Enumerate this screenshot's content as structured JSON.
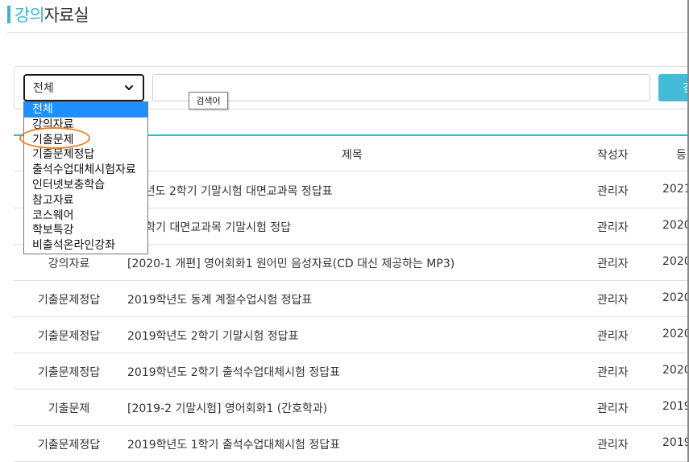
{
  "page": {
    "title_accent": "강의",
    "title_rest": "자료실"
  },
  "search": {
    "select_value": "전체",
    "tooltip": "검색어",
    "button_label": "검",
    "input_value": ""
  },
  "dropdown": {
    "options": [
      "전체",
      "강의자료",
      "기출문제",
      "기출문제정답",
      "출석수업대체시험자료",
      "인터넷보충학습",
      "참고자료",
      "코스웨어",
      "학보특강",
      "비출석온라인강좌"
    ],
    "selected": "전체",
    "highlighted": "기출문제"
  },
  "table": {
    "headers": {
      "category": "",
      "title": "제목",
      "author": "작성자",
      "date": "등"
    },
    "rows": [
      {
        "category": "",
        "title": "0학년도 2학기 기말시험 대면교과목 정답표",
        "author": "관리자",
        "date": "2021"
      },
      {
        "category": "",
        "title": "0.1학기 대면교과목 기말시험 정답",
        "author": "관리자",
        "date": "2020"
      },
      {
        "category": "강의자료",
        "title": "[2020-1 개편] 영어회화1 원어민 음성자료(CD 대신 제공하는 MP3)",
        "author": "관리자",
        "date": "2020"
      },
      {
        "category": "기출문제정답",
        "title": "2019학년도 동계 계절수업시험 정답표",
        "author": "관리자",
        "date": "2020"
      },
      {
        "category": "기출문제정답",
        "title": "2019학년도 2학기 기말시험 정답표",
        "author": "관리자",
        "date": "2020"
      },
      {
        "category": "기출문제정답",
        "title": "2019학년도 2학기 출석수업대체시험 정답표",
        "author": "관리자",
        "date": "2020"
      },
      {
        "category": "기출문제",
        "title": "[2019-2 기말시험] 영어회화1 (간호학과)",
        "author": "관리자",
        "date": "2019"
      },
      {
        "category": "기출문제정답",
        "title": "2019학년도 1학기 출석수업대체시험 정답표",
        "author": "관리자",
        "date": "2019"
      }
    ]
  },
  "colors": {
    "accent": "#39b5d0",
    "button": "#44bbd8",
    "selected_option": "#1e90ff",
    "highlight_ring": "#f0821e"
  }
}
